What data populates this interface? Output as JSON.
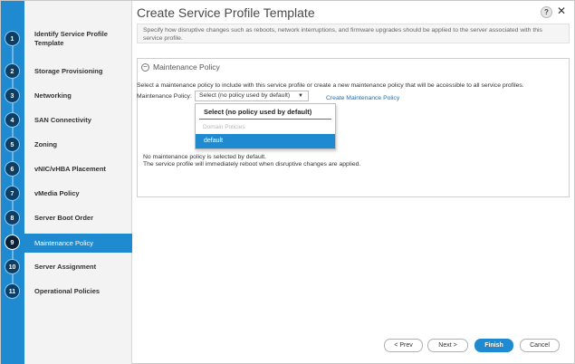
{
  "dialog": {
    "title": "Create Service Profile Template",
    "help_label": "?",
    "close_label": "✕",
    "info_text": "Specify how disruptive changes such as reboots, network interruptions, and firmware upgrades should be applied to the server associated with this service profile."
  },
  "steps": [
    {
      "num": "1",
      "label": "Identify Service Profile Template"
    },
    {
      "num": "2",
      "label": "Storage Provisioning"
    },
    {
      "num": "3",
      "label": "Networking"
    },
    {
      "num": "4",
      "label": "SAN Connectivity"
    },
    {
      "num": "5",
      "label": "Zoning"
    },
    {
      "num": "6",
      "label": "vNIC/vHBA Placement"
    },
    {
      "num": "7",
      "label": "vMedia Policy"
    },
    {
      "num": "8",
      "label": "Server Boot Order"
    },
    {
      "num": "9",
      "label": "Maintenance Policy"
    },
    {
      "num": "10",
      "label": "Server Assignment"
    },
    {
      "num": "11",
      "label": "Operational Policies"
    }
  ],
  "active_step": "9",
  "panel": {
    "title": "Maintenance Policy",
    "collapse_symbol": "−",
    "description": "Select a maintenance policy to include with this service profile or create a new maintenance policy that will be accessible to all service profiles.",
    "field_label": "Maintenance Policy:",
    "selected_value": "Select (no policy used by default)",
    "arrow": "▼",
    "create_link": "Create Maintenance Policy",
    "dropdown": {
      "option_default": "Select (no policy used by default)",
      "group_header": "Domain Policies",
      "highlighted_option": "default"
    },
    "note_line1": "No maintenance policy is selected by default.",
    "note_line2": "The service profile will immediately reboot when disruptive changes are applied."
  },
  "footer": {
    "prev": "< Prev",
    "next": "Next >",
    "finish": "Finish",
    "cancel": "Cancel"
  }
}
